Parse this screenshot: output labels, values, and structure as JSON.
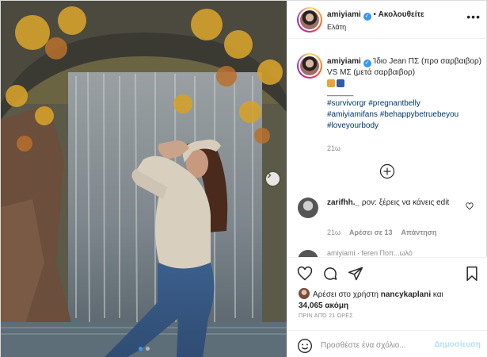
{
  "post": {
    "username": "amiyiami",
    "follow_label": "Ακολουθείτε",
    "location": "Ελάτη",
    "caption_text": "Ίδιο Jean ΠΣ (προ σαρβαιβορ) VS ΜΣ (μετά σαρβαιβορ)",
    "divider": "______",
    "hashtags": [
      "#survivorgr",
      "#pregnantbelly",
      "#amiyiamifans",
      "#behappybetruebeyou",
      "#loveyourbody"
    ],
    "caption_time": "21ω",
    "image_dots": 2,
    "active_dot": 1
  },
  "comments": [
    {
      "username": "zarifhh._",
      "text": "ρον: ξέρεις να κάνεις edit",
      "time": "21ω",
      "likes": "Αρέσει σε 13",
      "reply": "Απάντηση"
    }
  ],
  "cutoff_comment": "amiyiami · feren Ποπ...ωλό",
  "likes": {
    "prefix": "Αρέσει στο χρήστη",
    "user": "nancykaplani",
    "and": "και",
    "count": "34,065 ακόμη"
  },
  "date": "ΠΡΙΝ ΑΠΌ 21 ΏΡΕΣ",
  "composer": {
    "placeholder": "Προσθέστε ένα σχόλιο...",
    "post_label": "Δημοσίευση"
  },
  "icons": [
    "verified-badge",
    "more-icon",
    "next-arrow-icon",
    "add-circle-icon",
    "heart-icon",
    "comment-icon",
    "share-icon",
    "bookmark-icon",
    "smile-icon"
  ],
  "colors": {
    "link": "#00376b",
    "verified": "#3897f0",
    "post_button_disabled": "#b2dffc",
    "muted": "#8e8e8e"
  }
}
